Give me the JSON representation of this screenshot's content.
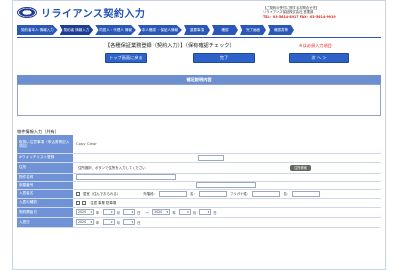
{
  "header": {
    "logo_text": "ﾘﾗｲｱﾝｽ",
    "title": "リライアンス契約入力",
    "contact_lines": [
      "【ご契約の受付に関するお問合せ先】",
      "リライアンス保証株式会社 営業部",
      "TEL：03-5614-8917  FAX：03-5614-9919"
    ]
  },
  "steps": [
    {
      "label": "契約者本人\n情報入力"
    },
    {
      "label": "契約者\n情報入力"
    },
    {
      "label": "同居人・代理人\n情報"
    },
    {
      "label": "本人確認\n・保証人情報"
    },
    {
      "label": "重要事項"
    },
    {
      "label": "確認"
    },
    {
      "label": "完了画面"
    },
    {
      "label": "確認書等"
    }
  ],
  "form": {
    "title": "【各種保証業務登録（契約入力）】（保有確認チェック）",
    "required_note": "※は必須入力項目",
    "back_top_label": "トップ画面に戻る",
    "complete_label": "完了",
    "next_label": "次 へ ＞",
    "section_bar": "補足説明内容",
    "section_label": "物件情報入力（共有）"
  },
  "rows": [
    {
      "label": "取扱い注意事項（申込書等記入項目）",
      "value": "Copy Clear"
    },
    {
      "label": "※ウォッチリスト登録",
      "value": ""
    },
    {
      "label": "住所",
      "value": "住所選択、ボタンで住所を入力してください",
      "button": "住所検索"
    },
    {
      "label": "物件名称",
      "value": ""
    },
    {
      "label": "部屋番号",
      "value": ""
    },
    {
      "label": "入居者名",
      "value": "居室（住んでおられる）",
      "extra": [
        "外階段：",
        "名：",
        "フリガナ姓：",
        "名："
      ]
    },
    {
      "label": "入居の種別",
      "value": "住居  事業  駐車場"
    },
    {
      "label": "契約開始日",
      "value": ""
    },
    {
      "label": "入居日",
      "value": ""
    }
  ],
  "dates": {
    "year": "2020",
    "year_unit": "年",
    "month": "月",
    "day": "日",
    "tilde": "～"
  },
  "colors": {
    "accent": "#2a57b8",
    "label_bg": "#6f93d6",
    "required": "#e22222"
  }
}
